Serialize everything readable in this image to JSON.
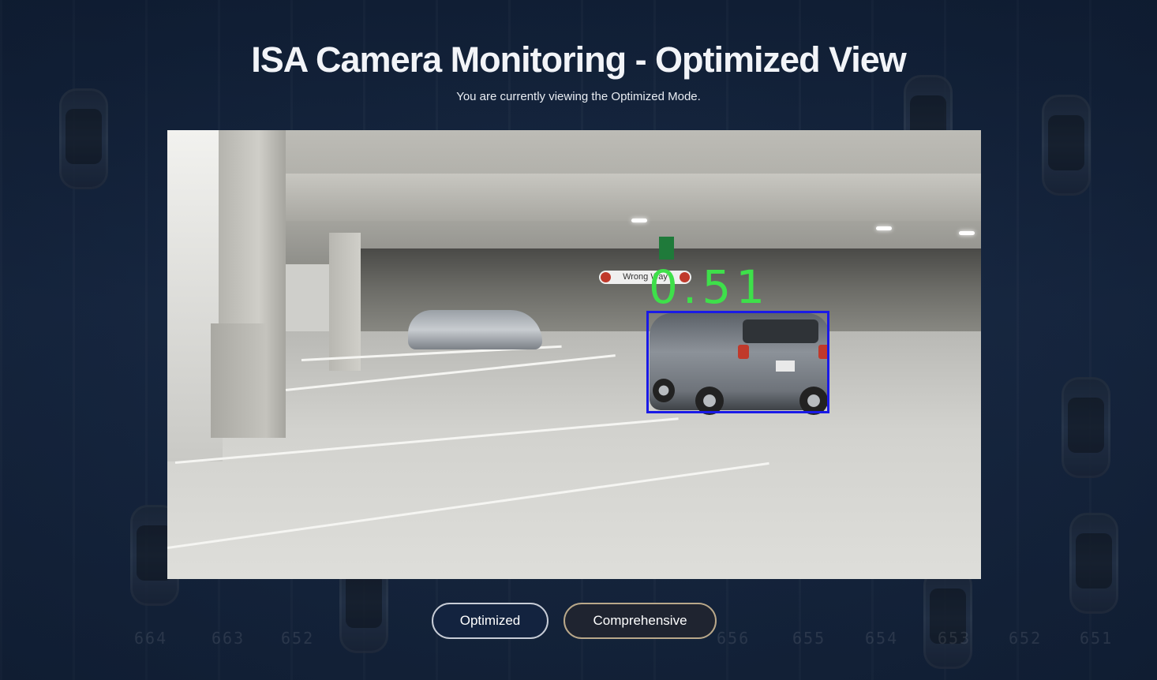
{
  "header": {
    "title": "ISA Camera Monitoring - Optimized View",
    "subtitle": "You are currently viewing the Optimized Mode."
  },
  "camera": {
    "sign_text": "Wrong Way",
    "detection": {
      "score": "0.51",
      "box_color": "#1a1ae6",
      "score_color": "#3ee04a"
    }
  },
  "background": {
    "stall_numbers": [
      "664",
      "663",
      "652",
      "656",
      "655",
      "654",
      "653",
      "652",
      "651"
    ]
  },
  "modes": {
    "optimized_label": "Optimized",
    "comprehensive_label": "Comprehensive",
    "active": "Optimized"
  },
  "colors": {
    "page_background": "#16263f",
    "title": "#f2f4f8"
  }
}
